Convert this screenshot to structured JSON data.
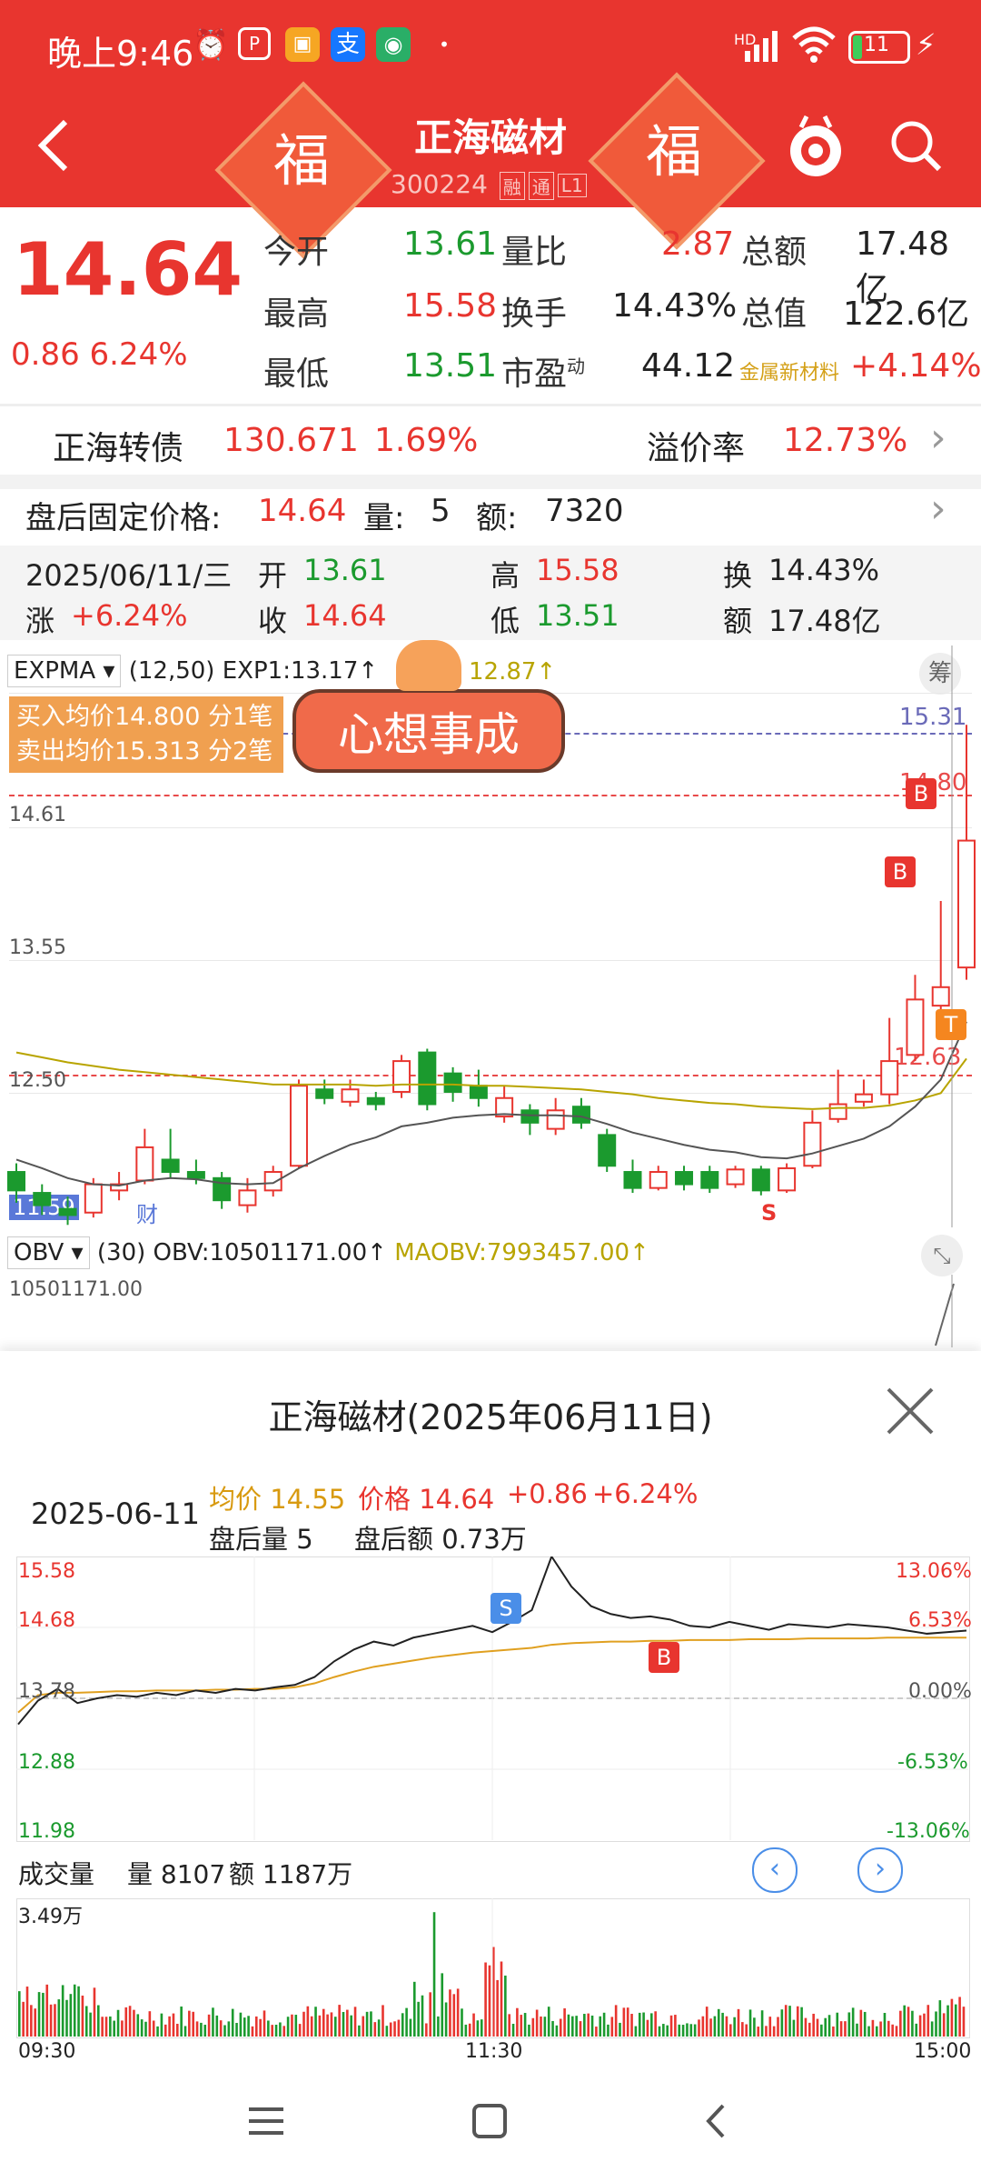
{
  "status": {
    "time": "晚上9:46",
    "hd": "HD",
    "battery": "11"
  },
  "header": {
    "back_icon": "back-arrow-icon",
    "fu": "福",
    "title": "正海磁材",
    "code": "300224",
    "tags": [
      "融",
      "通",
      "L1"
    ],
    "search_icon": "search-icon"
  },
  "quote": {
    "price": "14.64",
    "change": "0.86",
    "change_pct": "6.24%",
    "cells": [
      {
        "label": "今开",
        "value": "13.61",
        "color": "green"
      },
      {
        "label": "量比",
        "value": "2.87",
        "color": "red"
      },
      {
        "label": "总额",
        "value": "17.48亿",
        "color": "black"
      },
      {
        "label": "最高",
        "value": "15.58",
        "color": "red"
      },
      {
        "label": "换手",
        "value": "14.43%",
        "color": "black"
      },
      {
        "label": "总值",
        "value": "122.6亿",
        "color": "black"
      },
      {
        "label": "最低",
        "value": "13.51",
        "color": "green"
      },
      {
        "label": "市盈",
        "sup": "动",
        "value": "44.12",
        "color": "black"
      }
    ],
    "sector": {
      "name": "金属新材料",
      "pct": "+4.14%"
    }
  },
  "bond": {
    "name": "正海转债",
    "price": "130.671",
    "pct": "1.69%",
    "premium_label": "溢价率",
    "premium": "12.73%"
  },
  "afterhours": {
    "label": "盘后固定价格:",
    "price": "14.64",
    "vol_label": "量:",
    "vol": "5",
    "amt_label": "额:",
    "amt": "7320"
  },
  "daybar": {
    "date": "2025/06/11/三",
    "open_label": "开",
    "open": "13.61",
    "high_label": "高",
    "high": "15.58",
    "turn_label": "换",
    "turn": "14.43%",
    "chg_label": "涨",
    "chg": "+6.24%",
    "close_label": "收",
    "close": "14.64",
    "low_label": "低",
    "low": "13.51",
    "amt_label": "额",
    "amt": "17.48亿"
  },
  "kline": {
    "indicator": "EXPMA",
    "params": "(12,50)",
    "exp1": "EXP1:13.17↑",
    "exp2": "12.87↑",
    "chou": "筹",
    "buy_avg": "买入均价14.800 分1笔",
    "sell_avg": "卖出均价15.313 分2笔",
    "banner": "心想事成",
    "price_labels": {
      "p1531": "15.31",
      "p1480": "14.80",
      "p1461": "14.61",
      "p1355": "13.55",
      "p1263": "12.63",
      "p1250": "12.50",
      "p1159": "11.59"
    },
    "cai": "财",
    "s_marker": "S",
    "b_marker": "B",
    "t_marker": "T"
  },
  "obv": {
    "label": "OBV",
    "params": "(30)",
    "obv": "OBV:10501171.00↑",
    "maobv": "MAOBV:7993457.00↑",
    "axis_top": "10501171.00"
  },
  "intraday": {
    "title": "正海磁材(2025年06月11日)",
    "date": "2025-06-11",
    "avg": "均价 14.55",
    "price": "价格 14.64",
    "chg": "+0.86",
    "pct": "+6.24%",
    "ah_vol": "盘后量  5",
    "ah_amt": "盘后额  0.73万",
    "y_left": [
      "15.58",
      "14.68",
      "13.78",
      "12.88",
      "11.98"
    ],
    "y_right": [
      "13.06%",
      "6.53%",
      "0.00%",
      "-6.53%",
      "-13.06%"
    ],
    "s_marker": "S",
    "b_marker": "B",
    "vol_label": "成交量",
    "vol": "量 8107",
    "amt": "额 1187万",
    "vol_max": "3.49万",
    "times": [
      "09:30",
      "11:30",
      "15:00"
    ]
  },
  "colors": {
    "brand_red": "#e8352f",
    "up": "#e8352f",
    "down": "#1b9a2e",
    "avg_line": "#e0a020"
  },
  "chart_data": [
    {
      "type": "line",
      "title": "正海磁材(2025年06月11日)",
      "x_range": [
        "09:30",
        "15:00"
      ],
      "ylim": [
        11.98,
        15.58
      ],
      "series": [
        {
          "name": "价格",
          "values": [
            13.45,
            13.75,
            13.9,
            13.72,
            13.78,
            13.82,
            13.8,
            13.85,
            13.82,
            13.88,
            13.85,
            13.9,
            13.88,
            13.92,
            13.95,
            14.05,
            14.25,
            14.4,
            14.5,
            14.45,
            14.55,
            14.6,
            14.65,
            14.7,
            14.62,
            14.75,
            14.9,
            15.58,
            15.2,
            14.95,
            14.85,
            14.8,
            14.82,
            14.78,
            14.7,
            14.68,
            14.75,
            14.7,
            14.65,
            14.72,
            14.7,
            14.68,
            14.72,
            14.7,
            14.68,
            14.64,
            14.6,
            14.62,
            14.64
          ]
        },
        {
          "name": "均价",
          "values": [
            13.6,
            13.82,
            13.85,
            13.85,
            13.86,
            13.87,
            13.87,
            13.88,
            13.88,
            13.88,
            13.89,
            13.89,
            13.9,
            13.9,
            13.92,
            13.97,
            14.05,
            14.12,
            14.18,
            14.22,
            14.26,
            14.3,
            14.33,
            14.36,
            14.38,
            14.4,
            14.42,
            14.46,
            14.48,
            14.49,
            14.5,
            14.5,
            14.51,
            14.51,
            14.52,
            14.52,
            14.52,
            14.53,
            14.53,
            14.53,
            14.54,
            14.54,
            14.54,
            14.54,
            14.55,
            14.55,
            14.55,
            14.55,
            14.55
          ]
        }
      ]
    },
    {
      "type": "bar",
      "title": "",
      "ylabel": "成交量",
      "ylim": [
        0,
        34900
      ]
    }
  ]
}
